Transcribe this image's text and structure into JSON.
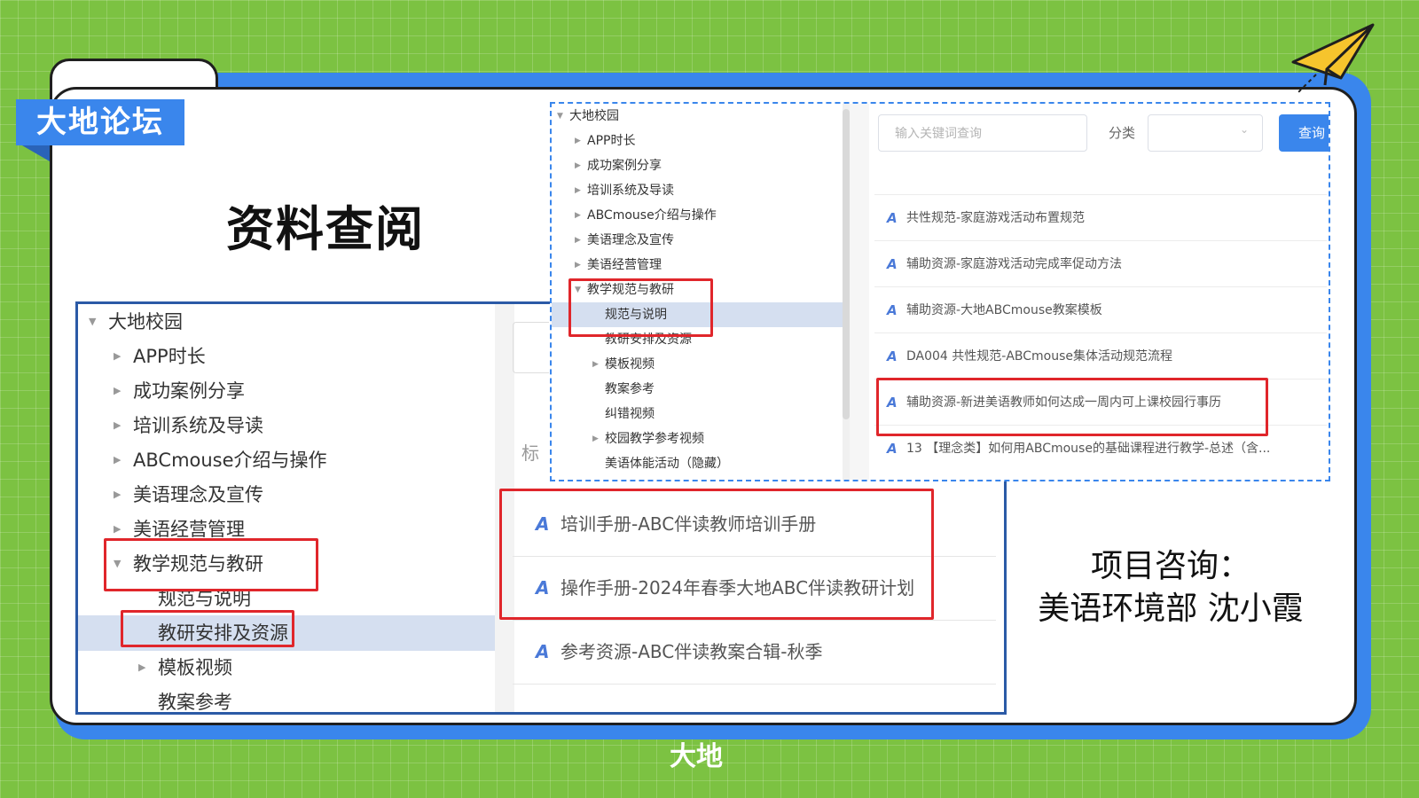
{
  "slide": {
    "badge": "大地论坛",
    "title": "资料查阅",
    "contact_line1": "项目咨询：",
    "contact_line2": "美语环境部 沈小霞",
    "footer_brand": "大地"
  },
  "colors": {
    "background": "#7cc242",
    "accent_blue": "#3a86ec",
    "highlight_red": "#e0262b"
  },
  "big_screenshot": {
    "tree": [
      {
        "label": "大地校园",
        "arrow": "▼"
      },
      {
        "label": "APP时长",
        "arrow": "▶"
      },
      {
        "label": "成功案例分享",
        "arrow": "▶"
      },
      {
        "label": "培训系统及导读",
        "arrow": "▶"
      },
      {
        "label": "ABCmouse介绍与操作",
        "arrow": "▶"
      },
      {
        "label": "美语理念及宣传",
        "arrow": "▶"
      },
      {
        "label": "美语经营管理",
        "arrow": "▶"
      },
      {
        "label": "教学规范与教研",
        "arrow": "▼"
      },
      {
        "label": "规范与说明",
        "arrow": ""
      },
      {
        "label": "教研安排及资源",
        "arrow": ""
      },
      {
        "label": "模板视频",
        "arrow": "▶"
      },
      {
        "label": "教案参考",
        "arrow": ""
      }
    ],
    "stub_text": "标",
    "results": [
      {
        "icon": "A",
        "text": "培训手册-ABC伴读教师培训手册"
      },
      {
        "icon": "A",
        "text": "操作手册-2024年春季大地ABC伴读教研计划"
      },
      {
        "icon": "A",
        "text": "参考资源-ABC伴读教案合辑-秋季"
      }
    ]
  },
  "small_screenshot": {
    "tree": [
      {
        "label": "大地校园",
        "arrow": "▼"
      },
      {
        "label": "APP时长",
        "arrow": "▶"
      },
      {
        "label": "成功案例分享",
        "arrow": "▶"
      },
      {
        "label": "培训系统及导读",
        "arrow": "▶"
      },
      {
        "label": "ABCmouse介绍与操作",
        "arrow": "▶"
      },
      {
        "label": "美语理念及宣传",
        "arrow": "▶"
      },
      {
        "label": "美语经营管理",
        "arrow": "▶"
      },
      {
        "label": "教学规范与教研",
        "arrow": "▼"
      },
      {
        "label": "规范与说明",
        "arrow": ""
      },
      {
        "label": "教研安排及资源",
        "arrow": ""
      },
      {
        "label": "模板视频",
        "arrow": "▶"
      },
      {
        "label": "教案参考",
        "arrow": ""
      },
      {
        "label": "纠错视频",
        "arrow": ""
      },
      {
        "label": "校园教学参考视频",
        "arrow": "▶"
      },
      {
        "label": "美语体能活动（隐藏）",
        "arrow": ""
      }
    ],
    "search_placeholder": "输入关键词查询",
    "category_label": "分类",
    "query_button": "查询",
    "results": [
      {
        "icon": "A",
        "text": "共性规范-家庭游戏活动布置规范"
      },
      {
        "icon": "A",
        "text": "辅助资源-家庭游戏活动完成率促动方法"
      },
      {
        "icon": "A",
        "text": "辅助资源-大地ABCmouse教案模板"
      },
      {
        "icon": "A",
        "text": "DA004 共性规范-ABCmouse集体活动规范流程"
      },
      {
        "icon": "A",
        "text": "辅助资源-新进美语教师如何达成一周内可上课校园行事历"
      },
      {
        "icon": "A",
        "text": "13 【理念类】如何用ABCmouse的基础课程进行教学-总述（含..."
      }
    ]
  }
}
